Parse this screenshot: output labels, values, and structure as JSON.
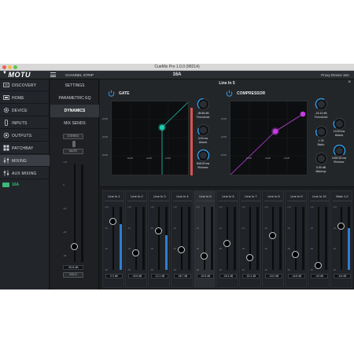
{
  "window": {
    "title": "CueMix Pro 1.0.0 (98214)"
  },
  "topbar": {
    "logo": "MOTU",
    "section": "CHANNEL STRIP",
    "device": "16A",
    "proxy": "Proxy Device 16A"
  },
  "sidebar": {
    "items": [
      {
        "label": "DISCOVERY",
        "icon": "discovery-icon"
      },
      {
        "label": "HOME",
        "icon": "home-icon"
      },
      {
        "label": "DEVICE",
        "icon": "gear-icon"
      },
      {
        "label": "INPUTS",
        "icon": "inputs-icon"
      },
      {
        "label": "OUTPUTS",
        "icon": "outputs-icon"
      },
      {
        "label": "PATCHBAY",
        "icon": "patchbay-icon"
      },
      {
        "label": "MIXING",
        "icon": "mixing-icon"
      },
      {
        "label": "AUX MIXING",
        "icon": "aux-mixing-icon"
      }
    ],
    "device": {
      "label": "16A",
      "icon": "device-icon"
    }
  },
  "menu": {
    "items": [
      "SETTINGS",
      "PARAMETRIC EQ",
      "DYNAMICS",
      "MIX SENDS"
    ],
    "stereo_label": "STEREO",
    "mute_label": "MUTE",
    "solo_label": "SOLO",
    "fader_value": "-50.8 dB",
    "fader_scale": [
      "+12",
      "0",
      "-10",
      "-20",
      "-30",
      "-40",
      "-60"
    ]
  },
  "main": {
    "channel_title": "Line In 5",
    "close_label": "×",
    "gate": {
      "title": "GATE",
      "x_ticks": [
        "-60dB",
        "-40dB",
        "-20dB",
        "0dB"
      ],
      "y_ticks": [
        "-20dB",
        "-40dB",
        "-60dB"
      ],
      "params": [
        {
          "value": "-35.56 dB",
          "label": "Threshold"
        },
        {
          "value": "4.00 ms",
          "label": "Attack"
        },
        {
          "value": "846.00 ms",
          "label": "Release"
        }
      ]
    },
    "compressor": {
      "title": "COMPRESSOR",
      "x_ticks": [
        "-60dB",
        "-40dB",
        "-20dB",
        "0dB"
      ],
      "y_ticks": [
        "-20dB",
        "-40dB",
        "-60dB"
      ],
      "params": [
        {
          "value": "-15.12 dB",
          "label": "Threshold"
        },
        {
          "value": "10.00 ms",
          "label": "Attack"
        },
        {
          "value": "1.76",
          "label": "Ratio"
        },
        {
          "value": "1000.00 ms",
          "label": "Release"
        },
        {
          "value": "0.00 dB",
          "label": "Makeup"
        }
      ]
    }
  },
  "mixer": {
    "scale": [
      "+12",
      "0",
      "-10",
      "-20",
      "-30",
      "-40",
      "-60"
    ],
    "channels": [
      {
        "name": "Line In 1",
        "value": "0.0 dB",
        "level": 0.78,
        "meter": 0.72
      },
      {
        "name": "Line In 2",
        "value": "-40.8 dB",
        "level": 0.28,
        "meter": 0.0
      },
      {
        "name": "Line In 3",
        "value": "-12.1 dB",
        "level": 0.62,
        "meter": 0.55
      },
      {
        "name": "Line In 4",
        "value": "-36.7 dB",
        "level": 0.32,
        "meter": 0.0
      },
      {
        "name": "Line In 5",
        "value": "-50.8 dB",
        "level": 0.22,
        "meter": 0.0
      },
      {
        "name": "Line In 6",
        "value": "-26.4 dB",
        "level": 0.42,
        "meter": 0.0
      },
      {
        "name": "Line In 7",
        "value": "-52.4 dB",
        "level": 0.2,
        "meter": 0.0
      },
      {
        "name": "Line In 8",
        "value": "-16.0 dB",
        "level": 0.55,
        "meter": 0.0
      },
      {
        "name": "Line In 9",
        "value": "-44.8 dB",
        "level": 0.25,
        "meter": 0.0
      },
      {
        "name": "Line In 10",
        "value": "-inf dB",
        "level": 0.08,
        "meter": 0.0
      },
      {
        "name": "Main 1-2",
        "value": "-6.6 dB",
        "level": 0.7,
        "meter": 0.66
      }
    ]
  },
  "colors": {
    "accent": "#2e7fd1",
    "gate": "#1fc9b0",
    "compressor": "#c53ee0",
    "gate_strip": "#d9534f",
    "device": "#3cb878"
  }
}
